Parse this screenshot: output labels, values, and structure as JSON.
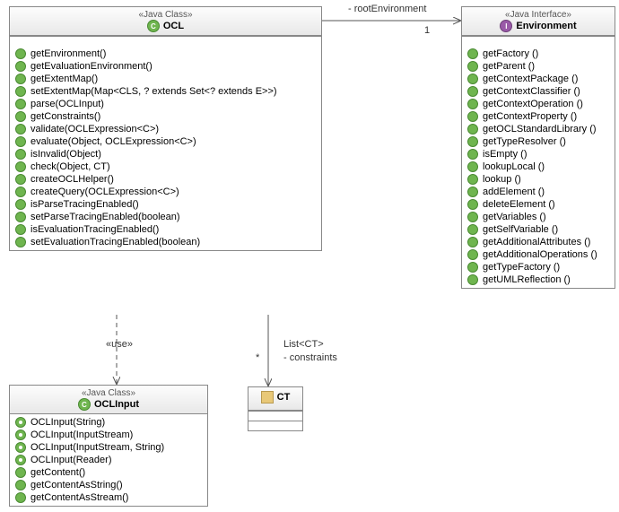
{
  "ocl": {
    "stereo": "«Java Class»",
    "name": "OCL",
    "methods": [
      "getEnvironment()",
      "getEvaluationEnvironment()",
      "getExtentMap()",
      "setExtentMap(Map<CLS, ? extends Set<? extends E>>)",
      "parse(OCLInput)",
      "getConstraints()",
      "validate(OCLExpression<C>)",
      "evaluate(Object, OCLExpression<C>)",
      "isInvalid(Object)",
      "check(Object, CT)",
      "createOCLHelper()",
      "createQuery(OCLExpression<C>)",
      "isParseTracingEnabled()",
      "setParseTracingEnabled(boolean)",
      "isEvaluationTracingEnabled()",
      "setEvaluationTracingEnabled(boolean)"
    ]
  },
  "env": {
    "stereo": "«Java Interface»",
    "name": "Environment",
    "methods": [
      "getFactory ()",
      "getParent ()",
      "getContextPackage ()",
      "getContextClassifier ()",
      "getContextOperation ()",
      "getContextProperty ()",
      "getOCLStandardLibrary ()",
      "getTypeResolver ()",
      "isEmpty ()",
      "lookupLocal ()",
      "lookup ()",
      "addElement ()",
      "deleteElement ()",
      "getVariables ()",
      "getSelfVariable ()",
      "getAdditionalAttributes ()",
      "getAdditionalOperations ()",
      "getTypeFactory ()",
      "getUMLReflection ()"
    ]
  },
  "input": {
    "stereo": "«Java Class»",
    "name": "OCLInput",
    "ctors": [
      "OCLInput(String)",
      "OCLInput(InputStream)",
      "OCLInput(InputStream, String)",
      "OCLInput(Reader)"
    ],
    "methods": [
      "getContent()",
      "getContentAsString()",
      "getContentAsStream()"
    ]
  },
  "ct": {
    "name": "CT"
  },
  "assoc": {
    "rootEnv": {
      "role": "- rootEnvironment",
      "mult": "1"
    },
    "constraints": {
      "type": "List<CT>",
      "role": "- constraints",
      "mult": "*"
    },
    "use": "«use»"
  }
}
